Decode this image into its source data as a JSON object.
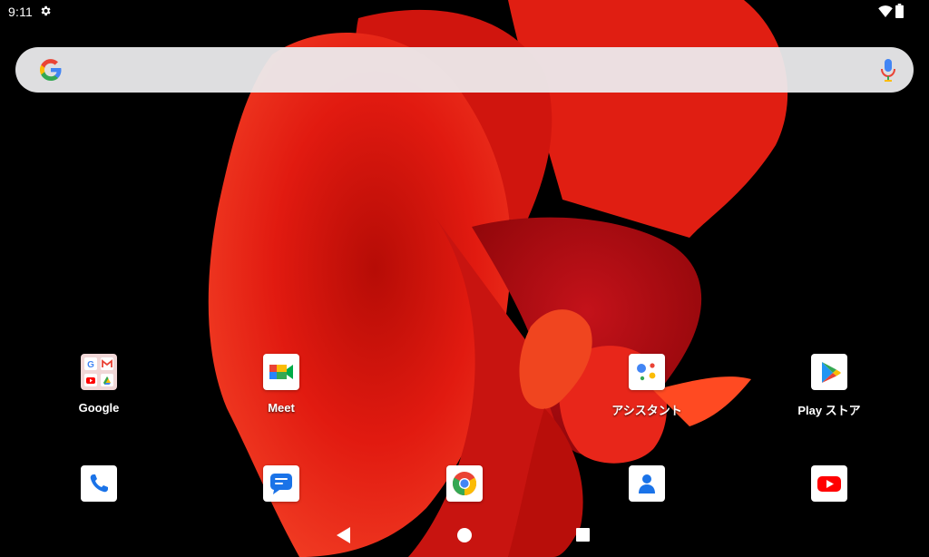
{
  "status_bar": {
    "time": "9:11",
    "icons": [
      "gear-icon",
      "wifi-icon",
      "battery-icon"
    ]
  },
  "search_bar": {
    "left_icon": "google-g-icon",
    "right_icon": "mic-icon"
  },
  "home_apps": [
    {
      "label": "Google",
      "icon": "google-folder-icon"
    },
    {
      "label": "Meet",
      "icon": "meet-icon"
    },
    {
      "label": "アシスタント",
      "icon": "assistant-icon"
    },
    {
      "label": "Play ストア",
      "icon": "play-store-icon"
    }
  ],
  "dock": [
    {
      "icon": "phone-icon"
    },
    {
      "icon": "messages-icon"
    },
    {
      "icon": "chrome-icon"
    },
    {
      "icon": "contacts-icon"
    },
    {
      "icon": "youtube-icon"
    }
  ],
  "nav_bar": {
    "icons": [
      "back-icon",
      "home-icon",
      "recents-icon"
    ]
  },
  "colors": {
    "background": "#000000",
    "search_bar": "#ececee",
    "wallpaper_red": "#d8150f",
    "google_blue": "#4285f4",
    "google_red": "#ea4335",
    "google_yellow": "#fbbc05",
    "google_green": "#34a853"
  }
}
